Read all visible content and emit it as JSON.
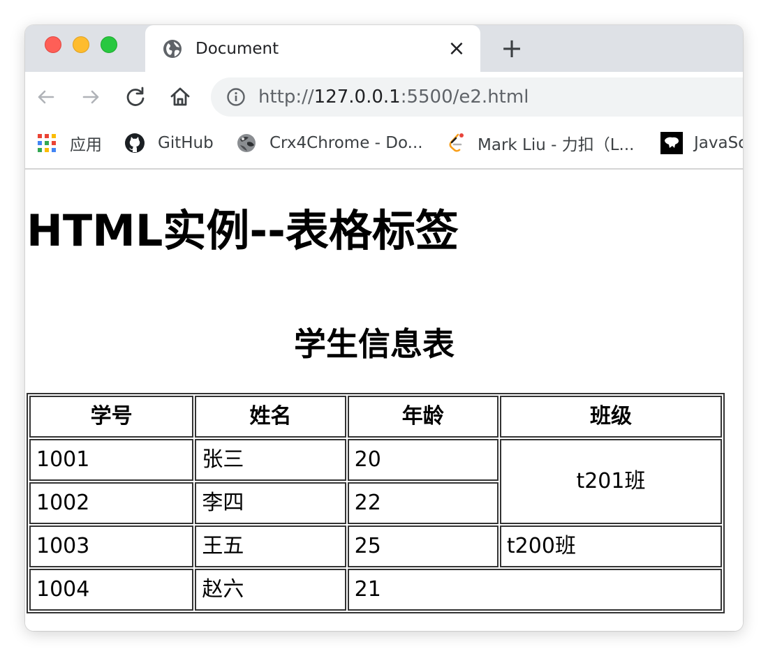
{
  "browser": {
    "tab": {
      "title": "Document",
      "icon": "globe-icon",
      "close_icon": "close-icon"
    },
    "new_tab_icon": "plus-icon",
    "toolbar": {
      "back_icon": "back-arrow-icon",
      "forward_icon": "forward-arrow-icon",
      "reload_icon": "reload-icon",
      "home_icon": "home-icon",
      "address": {
        "info_icon": "info-icon",
        "scheme": "http://",
        "host": "127.0.0.1",
        "path": ":5500/e2.html"
      }
    },
    "bookmarks": [
      {
        "label": "应用",
        "icon": "apps-grid-icon"
      },
      {
        "label": "GitHub",
        "icon": "github-icon"
      },
      {
        "label": "Crx4Chrome - Do...",
        "icon": "crx4chrome-icon"
      },
      {
        "label": "Mark Liu - 力扣（L...",
        "icon": "leetcode-icon"
      },
      {
        "label": "JavaSc",
        "icon": "javascript-icon"
      }
    ]
  },
  "page": {
    "heading": "HTML实例--表格标签",
    "table": {
      "caption": "学生信息表",
      "headers": [
        "学号",
        "姓名",
        "年龄",
        "班级"
      ],
      "rows": [
        {
          "id": "1001",
          "name": "张三",
          "age": "20"
        },
        {
          "id": "1002",
          "name": "李四",
          "age": "22"
        },
        {
          "id": "1003",
          "name": "王五",
          "age": "25",
          "class": "t200班"
        },
        {
          "id": "1004",
          "name": "赵六",
          "age": "21"
        }
      ],
      "merged_class": "t201班"
    }
  },
  "colors": {
    "tabstrip": "#dee1e6",
    "close_light": "#fe5f57",
    "minimize_light": "#febc2e",
    "zoom_light": "#28c840",
    "omnibox": "#f1f3f4",
    "table_border": "#333333"
  }
}
